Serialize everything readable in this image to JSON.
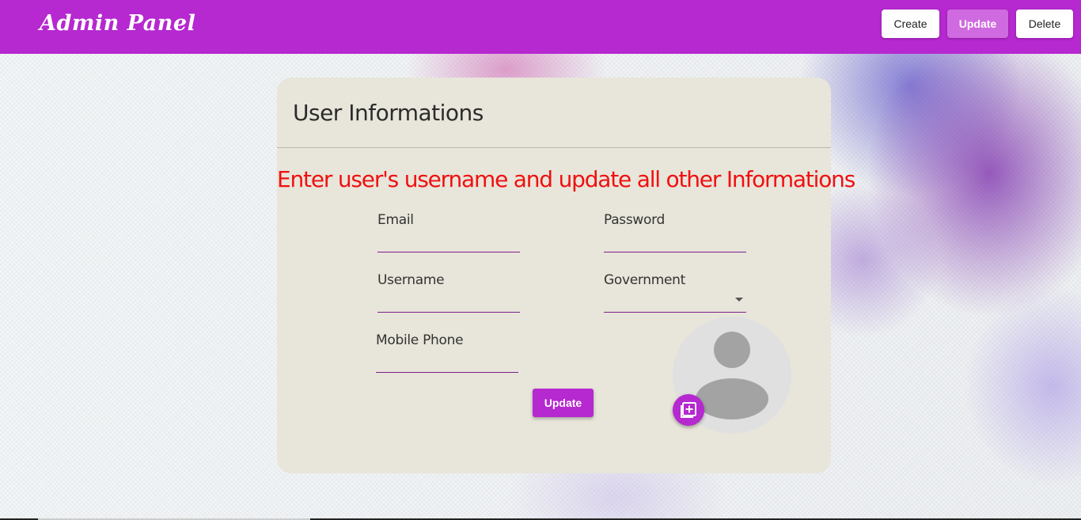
{
  "appbar": {
    "brand": "Admin Panel",
    "nav": {
      "create_label": "Create",
      "update_label": "Update",
      "delete_label": "Delete"
    },
    "color": "#b628d0"
  },
  "card": {
    "title": "User Informations",
    "instructions": "Enter user's username and update all other Informations",
    "fields": {
      "email": {
        "label": "Email",
        "value": ""
      },
      "password": {
        "label": "Password",
        "value": ""
      },
      "username": {
        "label": "Username",
        "value": ""
      },
      "government": {
        "label": "Government",
        "value": ""
      },
      "mobile_phone": {
        "label": "Mobile Phone",
        "value": ""
      }
    },
    "submit_label": "Update",
    "avatar_icon": "person-placeholder-icon",
    "add_photo_icon": "add-photo-library-icon"
  },
  "colors": {
    "accent": "#b628d0",
    "active_nav": "#d06ae0",
    "card_bg": "#e8e5da",
    "instruction_text": "#f01010"
  }
}
